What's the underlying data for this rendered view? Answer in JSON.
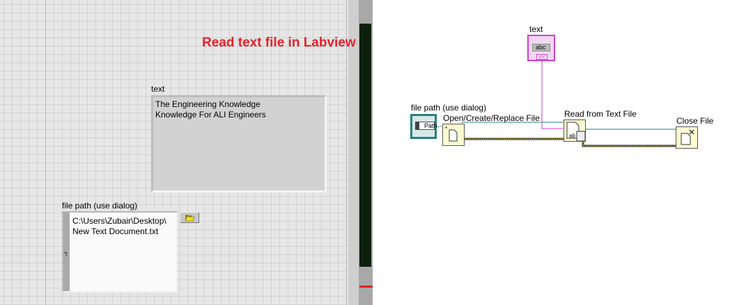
{
  "front_panel": {
    "title": "Read text file in Labview",
    "text_indicator": {
      "label": "text",
      "lines": [
        "The Engineering Knowledge",
        "Knowledge For ALI Engineers"
      ]
    },
    "path_control": {
      "label": "file path (use dialog)",
      "lines": [
        "C:\\Users\\Zubair\\Desktop\\",
        "New Text Document.txt"
      ],
      "browse_icon": "folder-open-icon"
    }
  },
  "block_diagram": {
    "text_terminal": {
      "label": "text",
      "glyph": "abc",
      "type": "abc"
    },
    "path_terminal": {
      "label": "file path (use dialog)",
      "glyph": "Path"
    },
    "nodes": [
      {
        "label": "Open/Create/Replace File",
        "icon": "open-file-icon"
      },
      {
        "label": "Read from Text File",
        "icon": "read-text-file-icon"
      },
      {
        "label": "Close File",
        "icon": "close-file-icon"
      }
    ],
    "colors": {
      "string_wire": "#d040d0",
      "refnum_wire": "#2a8080",
      "error_wire": "#d8d000",
      "node_bg": "#fdfbd2"
    }
  }
}
